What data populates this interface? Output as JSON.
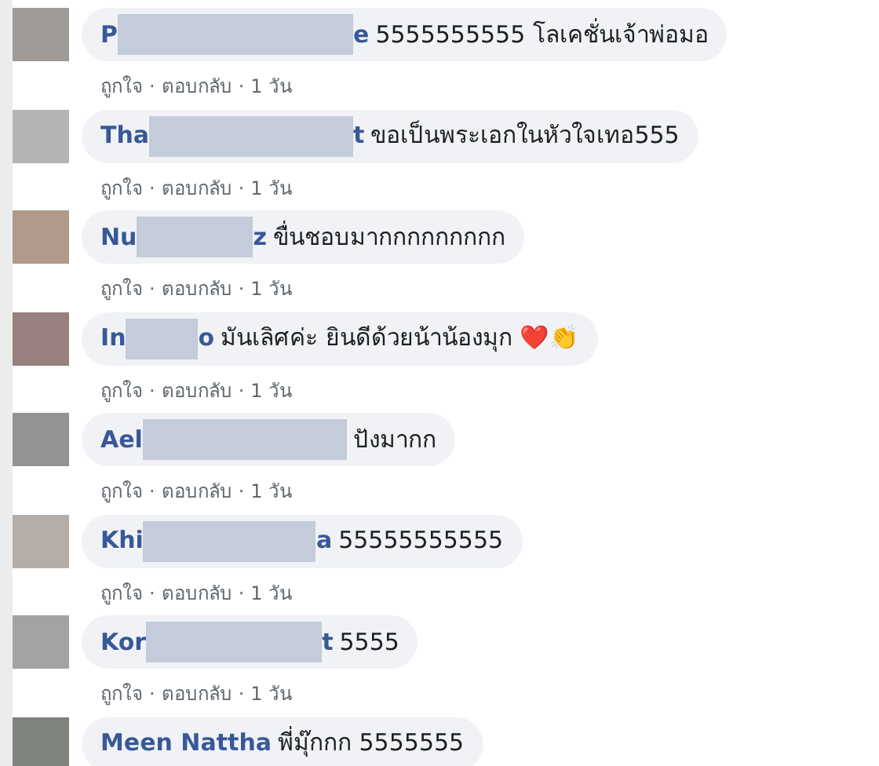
{
  "comments": [
    {
      "color": "#a09b96",
      "name_start": "P",
      "name_end": "e",
      "text": "5555555555 โลเคชั่นเจ้าพ่อมอ",
      "actions": [
        "ถูกใจ",
        "ตอบกลับ",
        "1 วัน"
      ]
    },
    {
      "color": "#b4b4b4",
      "name_start": "Tha",
      "name_end": "t",
      "text": "ขอเป็นพระเอกในหัวใจเทอ555",
      "actions": [
        "ถูกใจ",
        "ตอบกลับ",
        "1 วัน"
      ]
    },
    {
      "color": "#b09a8c",
      "name_start": "Nu",
      "name_end": "z",
      "text": "ขื่นชอบมากกกกกกกกก",
      "actions": [
        "ถูกใจ",
        "ตอบกลับ",
        "1 วัน"
      ]
    },
    {
      "color": "#98807e",
      "name_start": "In",
      "name_end": "o",
      "text": "มันเลิศค่ะ ยินดีด้วยน้าน้องมุก ❤️👏",
      "actions": [
        "ถูกใจ",
        "ตอบกลับ",
        "1 วัน"
      ]
    },
    {
      "color": "#939294",
      "name_start": "Ael",
      "text": "ปังมากก",
      "actions": [
        "ถูกใจ",
        "ตอบกลับ",
        "1 วัน"
      ]
    },
    {
      "color": "#b5ada8",
      "name_start": "Khi",
      "name_end": "a",
      "text": "55555555555",
      "actions": [
        "ถูกใจ",
        "ตอบกลับ",
        "1 วัน"
      ]
    },
    {
      "color": "#a3a3a3",
      "name_start": "Kor",
      "name_end": "t",
      "text": "5555",
      "actions": [
        "ถูกใจ",
        "ตอบกลับ",
        "1 วัน"
      ]
    },
    {
      "color": "#7e847c",
      "name_start": "Meen Nattha",
      "text": "พี่มุ๊กกก 5555555"
    }
  ],
  "separator": "·"
}
